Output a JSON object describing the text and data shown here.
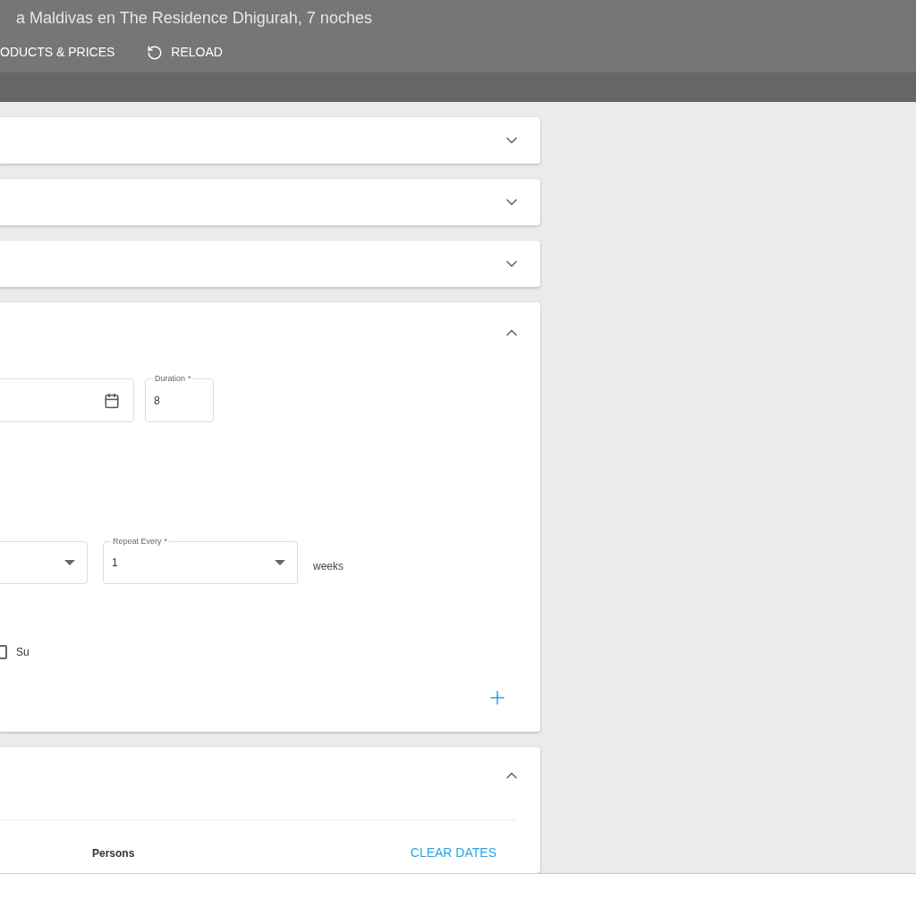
{
  "header": {
    "title": "a Maldivas en The Residence Dhigurah, 7 noches"
  },
  "toolbar": [
    {
      "kind": "text",
      "label": "ODUCTS & PRICES"
    },
    {
      "kind": "reload",
      "label": "RELOAD"
    }
  ],
  "sections": [
    {
      "kind": "collapsed",
      "expanded": false
    },
    {
      "kind": "collapsed",
      "expanded": false
    },
    {
      "kind": "collapsed",
      "expanded": false
    },
    {
      "kind": "schedule",
      "expanded": true,
      "date_field": {
        "kind": "date"
      },
      "duration": {
        "label": "Duration",
        "required_mark": "*",
        "value": "8"
      },
      "period_select": {
        "kind": "select"
      },
      "repeat": {
        "label": "Repeat Every",
        "required_mark": "*",
        "value": "1"
      },
      "unit": "weeks",
      "days": [
        {
          "label": "Su",
          "checked": false
        }
      ]
    },
    {
      "kind": "persons",
      "expanded": true,
      "persons_label": "Persons",
      "clear_button": "CLEAR DATES"
    }
  ]
}
